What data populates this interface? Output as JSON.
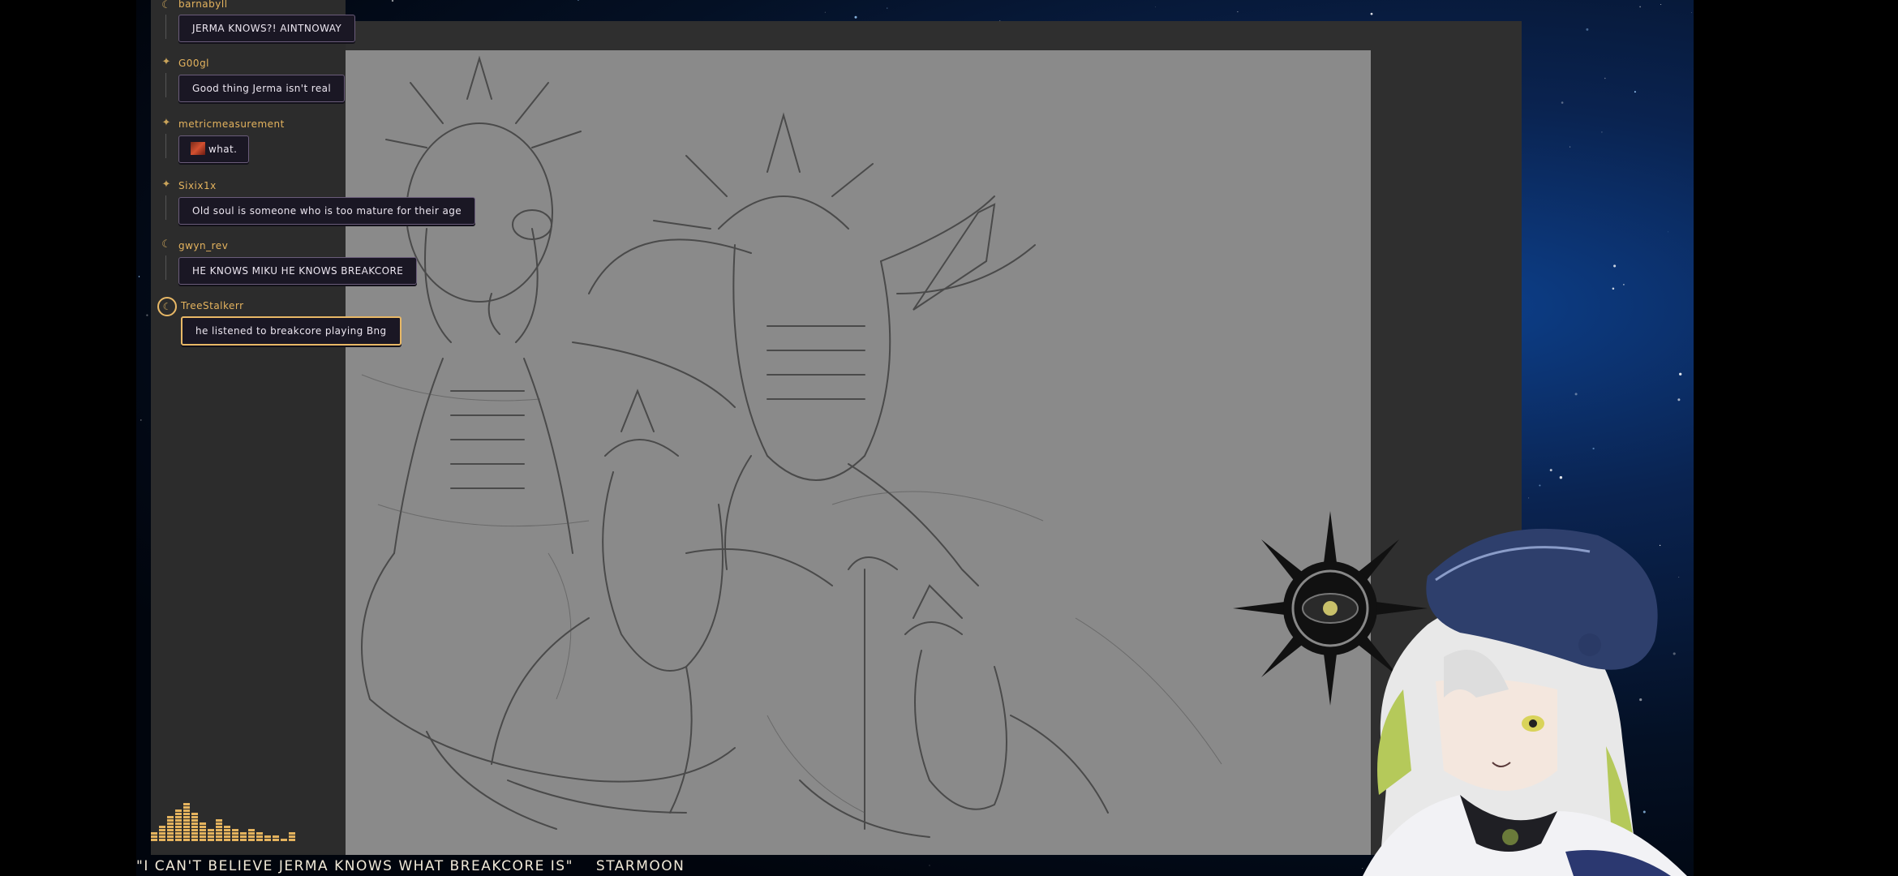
{
  "chat": {
    "messages": [
      {
        "user": "barnabyll",
        "text": "JERMA KNOWS?! AINTNOWAY",
        "badge": "crescent-moon"
      },
      {
        "user": "G00gl",
        "text": "Good thing Jerma isn't real",
        "badge": "sparkle"
      },
      {
        "user": "metricmeasurement",
        "text": "what.",
        "badge": "sparkle",
        "emote": "emote-image"
      },
      {
        "user": "Sixix1x",
        "text": "Old soul is someone who is too mature for their age",
        "badge": "sparkle"
      },
      {
        "user": "gwyn_rev",
        "text": "HE KNOWS MIKU HE KNOWS BREAKCORE",
        "badge": "crescent-moon"
      },
      {
        "user": "TreeStalkerr",
        "text": "he listened to breakcore playing Bng",
        "badge": "moon-circle",
        "highlighted": true
      }
    ]
  },
  "caption": {
    "quote": "\"I CAN'T BELIEVE JERMA KNOWS WHAT BREAKCORE IS\"",
    "name": "STARMOON"
  },
  "audio_visualizer": {
    "levels": [
      0.18,
      0.35,
      0.55,
      0.7,
      0.85,
      0.62,
      0.45,
      0.3,
      0.5,
      0.38,
      0.28,
      0.22,
      0.3,
      0.2,
      0.15,
      0.12,
      0.1,
      0.18
    ]
  },
  "colors": {
    "accent_gold": "#e4b35e",
    "bubble_bg": "#1a1724",
    "canvas_gray": "#8a8a8a",
    "panel_dark": "#2c2c2c"
  }
}
